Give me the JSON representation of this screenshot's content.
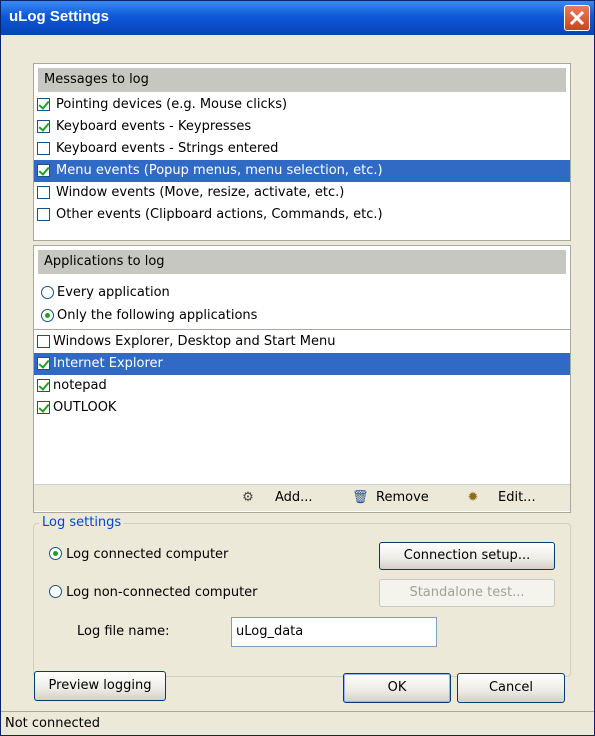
{
  "window": {
    "title": "uLog Settings"
  },
  "messages": {
    "header": "Messages to log",
    "items": [
      {
        "label": "Pointing devices (e.g. Mouse clicks)",
        "checked": true,
        "selected": false
      },
      {
        "label": "Keyboard events - Keypresses",
        "checked": true,
        "selected": false
      },
      {
        "label": "Keyboard events - Strings entered",
        "checked": false,
        "selected": false
      },
      {
        "label": "Menu events (Popup menus, menu selection, etc.)",
        "checked": true,
        "selected": true
      },
      {
        "label": "Window events (Move, resize, activate, etc.)",
        "checked": false,
        "selected": false
      },
      {
        "label": "Other events (Clipboard actions, Commands, etc.)",
        "checked": false,
        "selected": false
      }
    ]
  },
  "applications": {
    "header": "Applications to log",
    "options": [
      {
        "label": "Every application",
        "selected": false
      },
      {
        "label": "Only the following applications",
        "selected": true
      }
    ],
    "items": [
      {
        "label": "Windows Explorer, Desktop and Start Menu",
        "checked": false,
        "selected": false
      },
      {
        "label": "Internet Explorer",
        "checked": true,
        "selected": true
      },
      {
        "label": "notepad",
        "checked": true,
        "selected": false
      },
      {
        "label": "OUTLOOK",
        "checked": true,
        "selected": false
      }
    ],
    "toolbar": {
      "add": "Add...",
      "remove": "Remove",
      "edit": "Edit..."
    }
  },
  "log_settings": {
    "legend": "Log settings",
    "connected_label": "Log connected computer",
    "connected_selected": true,
    "nonconnected_label": "Log non-connected computer",
    "nonconnected_selected": false,
    "connection_setup": "Connection setup...",
    "standalone_test": "Standalone test...",
    "file_name_label": "Log file name:",
    "file_name_value": "uLog_data"
  },
  "buttons": {
    "preview": "Preview logging",
    "ok": "OK",
    "cancel": "Cancel"
  },
  "status": "Not connected",
  "colors": {
    "selection": "#316ac5",
    "titlebar": "#0d58d8",
    "legend": "#0046d5",
    "check": "#21a121"
  }
}
